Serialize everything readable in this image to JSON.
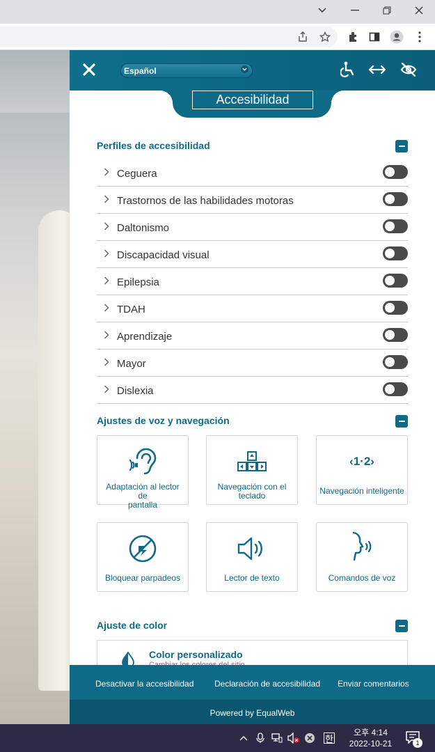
{
  "panel": {
    "language": "Español",
    "title": "Accesibilidad"
  },
  "profiles": {
    "title": "Perfiles de accesibilidad",
    "items": [
      {
        "label": "Ceguera",
        "enabled": false
      },
      {
        "label": "Trastornos de las habilidades motoras",
        "enabled": false
      },
      {
        "label": "Daltonismo",
        "enabled": false
      },
      {
        "label": "Discapacidad visual",
        "enabled": false
      },
      {
        "label": "Epilepsia",
        "enabled": false
      },
      {
        "label": "TDAH",
        "enabled": false
      },
      {
        "label": "Aprendizaje",
        "enabled": false
      },
      {
        "label": "Mayor",
        "enabled": false
      },
      {
        "label": "Dislexia",
        "enabled": false
      }
    ]
  },
  "voice_nav": {
    "title": "Ajustes de voz y navegación",
    "tiles": [
      {
        "label_1": "Adaptación al lector de",
        "label_2": "pantalla",
        "icon": "ear-icon"
      },
      {
        "label_1": "Navegación con el",
        "label_2": "teclado",
        "icon": "keyboard-arrows-icon"
      },
      {
        "label_1": "Navegación inteligente",
        "label_2": "",
        "icon": "smart-navigation-icon"
      },
      {
        "label_1": "Bloquear parpadeos",
        "label_2": "",
        "icon": "block-flash-icon"
      },
      {
        "label_1": "Lector de texto",
        "label_2": "",
        "icon": "speaker-icon"
      },
      {
        "label_1": "Comandos de voz",
        "label_2": "",
        "icon": "voice-command-icon"
      }
    ],
    "smart_nav_glyph": "‹1·2›"
  },
  "color": {
    "title": "Ajuste de color",
    "card_title": "Color personalizado",
    "card_subtitle": "Cambiar los colores del sitio"
  },
  "footer": {
    "disable": "Desactivar la accesibilidad",
    "statement": "Declaración de accesibilidad",
    "feedback": "Enviar comentarios",
    "powered": "Powered by EqualWeb"
  },
  "taskbar": {
    "time": "오후 4:14",
    "date": "2022-10-21",
    "notifications": "1",
    "ime": "한"
  },
  "colors": {
    "accent": "#0e6a86",
    "toggle_off": "#4a4a4a"
  }
}
